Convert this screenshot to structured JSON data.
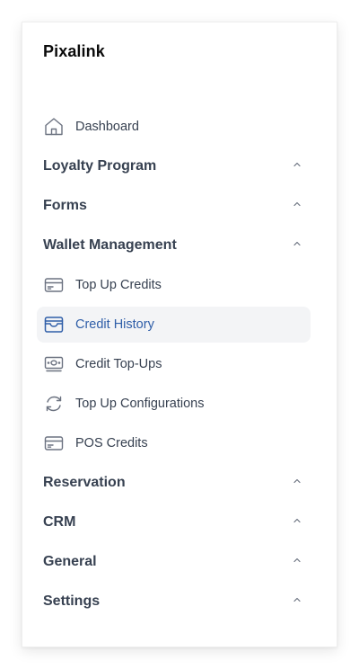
{
  "brand": "Pixalink",
  "nav": {
    "dashboard": {
      "label": "Dashboard",
      "icon": "home-icon"
    },
    "loyalty_program": {
      "label": "Loyalty Program"
    },
    "forms": {
      "label": "Forms"
    },
    "wallet_management": {
      "label": "Wallet Management",
      "items": [
        {
          "label": "Top Up Credits",
          "icon": "credit-card-icon"
        },
        {
          "label": "Credit History",
          "icon": "wallet-icon",
          "active": true
        },
        {
          "label": "Credit Top-Ups",
          "icon": "banknote-icon"
        },
        {
          "label": "Top Up Configurations",
          "icon": "refresh-icon"
        },
        {
          "label": "POS Credits",
          "icon": "credit-card-icon"
        }
      ]
    },
    "reservation": {
      "label": "Reservation"
    },
    "crm": {
      "label": "CRM"
    },
    "general": {
      "label": "General"
    },
    "settings": {
      "label": "Settings"
    }
  },
  "colors": {
    "active_text": "#2f5ea8",
    "active_bg": "#f3f4f6",
    "icon_gray": "#6b7280"
  }
}
